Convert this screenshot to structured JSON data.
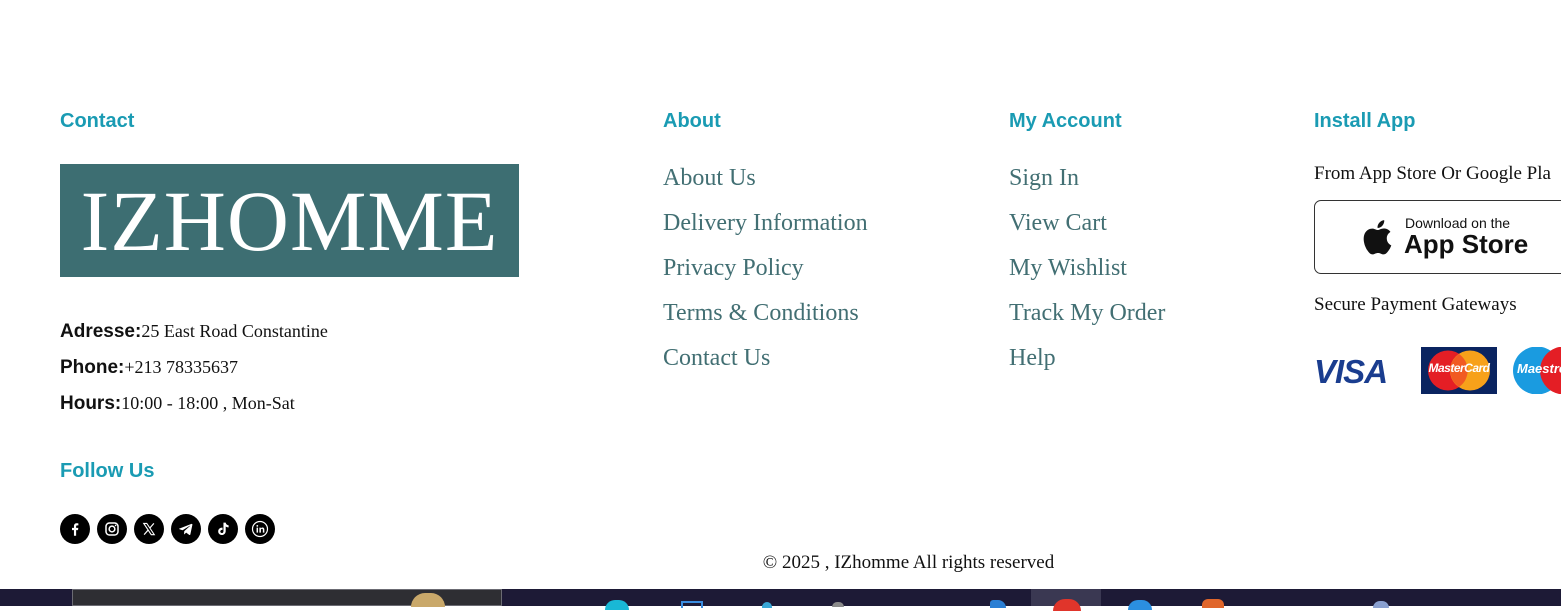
{
  "contact": {
    "title": "Contact",
    "logo_text": "IZHOMME",
    "address_label": "Adresse:",
    "address_value": "25 East Road Constantine",
    "phone_label": "Phone:",
    "phone_value": "+213 78335637",
    "hours_label": "Hours:",
    "hours_value": "10:00 - 18:00 , Mon-Sat"
  },
  "follow": {
    "title": "Follow Us",
    "icons": [
      "facebook-icon",
      "instagram-icon",
      "x-icon",
      "telegram-icon",
      "tiktok-icon",
      "linkedin-icon"
    ]
  },
  "about": {
    "title": "About",
    "links": [
      "About Us",
      "Delivery Information",
      "Privacy Policy",
      "Terms & Conditions",
      "Contact Us"
    ]
  },
  "account": {
    "title": "My Account",
    "links": [
      "Sign In",
      "View Cart",
      "My Wishlist",
      "Track My Order",
      "Help"
    ]
  },
  "install": {
    "title": "Install App",
    "subtitle": "From App Store Or Google Pla",
    "store_small": "Download on the",
    "store_big": "App Store",
    "payment_title": "Secure Payment Gateways",
    "visa_text": "VISA",
    "mastercard_text": "MasterCard",
    "maestro_text": "Maestro"
  },
  "footer": {
    "copyright": "© 2025 , IZhomme All rights reserved"
  },
  "colors": {
    "accent": "#1a9bb3",
    "link": "#426f73",
    "logo_bg": "#3d6e72",
    "taskbar": "#1d1a36"
  }
}
